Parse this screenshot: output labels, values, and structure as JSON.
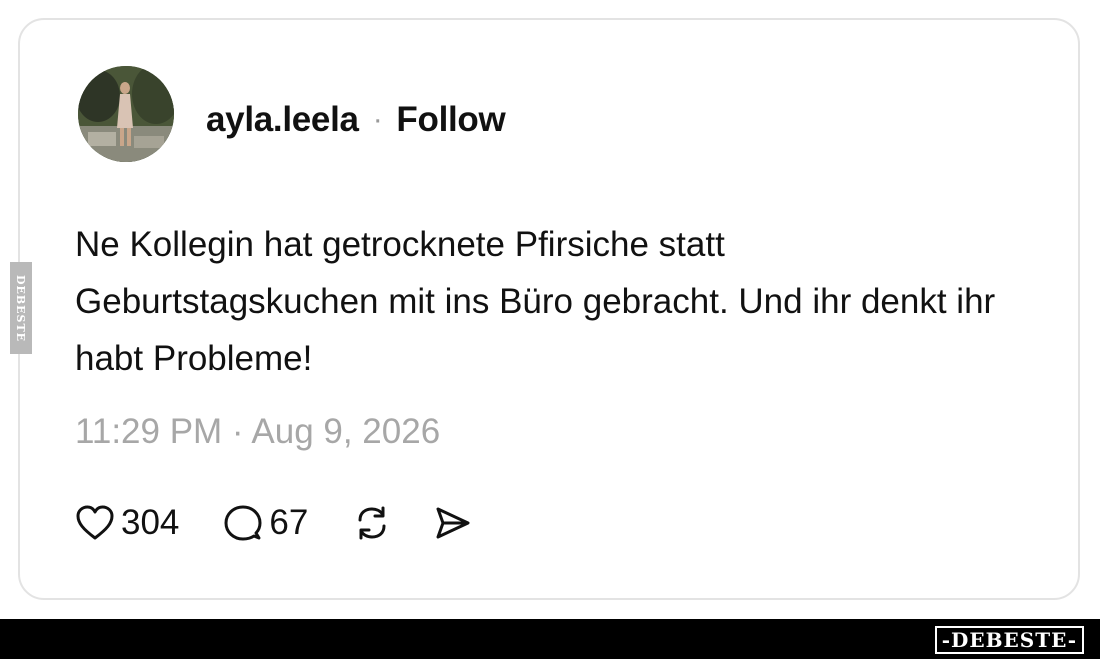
{
  "post": {
    "username": "ayla.leela",
    "separator": "·",
    "follow_label": "Follow",
    "text": "Ne Kollegin hat getrocknete Pfirsiche statt Geburtstagskuchen mit ins Büro gebracht. Und ihr denkt ihr habt Probleme!",
    "timestamp": "11:29 PM · Aug 9, 2026"
  },
  "actions": {
    "likes": "304",
    "replies": "67",
    "icons": [
      "heart-icon",
      "comment-icon",
      "repost-icon",
      "share-icon"
    ]
  },
  "watermark": {
    "side_label": "DEBESTE",
    "brand_label": "-DEBESTE-"
  }
}
